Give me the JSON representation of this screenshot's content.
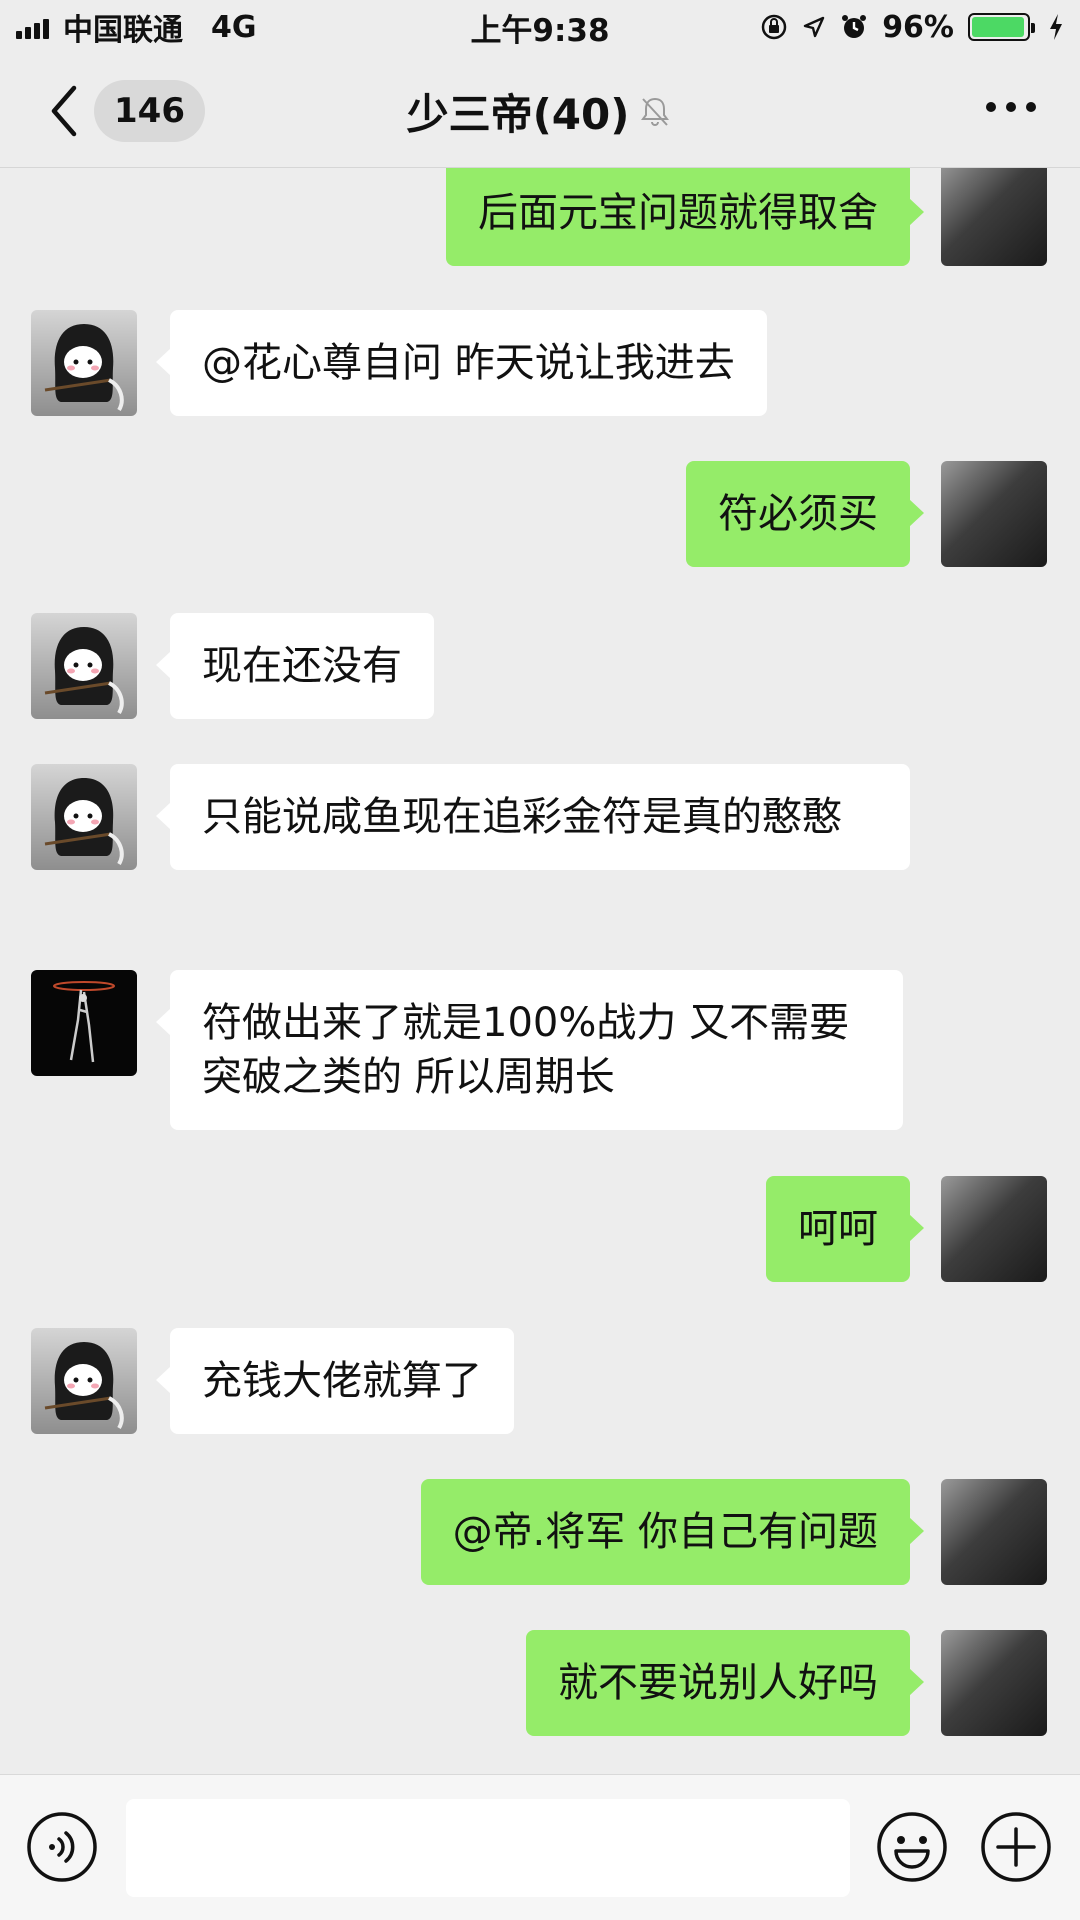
{
  "status_bar": {
    "carrier": "中国联通",
    "network": "4G",
    "time": "上午9:38",
    "battery": "96%",
    "battery_level": 0.96,
    "icons": [
      "signal-icon",
      "orientation-lock-icon",
      "location-icon",
      "alarm-icon",
      "battery-icon",
      "charging-icon"
    ]
  },
  "nav": {
    "back_count": "146",
    "title": "少三帝(40)",
    "icons": [
      "back-chevron-icon",
      "mute-bell-icon",
      "more-icon"
    ]
  },
  "messages": [
    {
      "side": "right",
      "avatar": "self",
      "text": "后面元宝问题就得取舍"
    },
    {
      "side": "left",
      "avatar": "reaper",
      "text": "@花心尊自问 昨天说让我进去"
    },
    {
      "side": "right",
      "avatar": "self",
      "text": "符必须买"
    },
    {
      "side": "left",
      "avatar": "reaper",
      "text": "现在还没有"
    },
    {
      "side": "left",
      "avatar": "reaper",
      "text": "只能说咸鱼现在追彩金符是真的憨憨"
    },
    {
      "side": "left",
      "avatar": "dark",
      "text": "符做出来了就是100%战力 又不需要突破之类的 所以周期长"
    },
    {
      "side": "right",
      "avatar": "self",
      "text": "呵呵"
    },
    {
      "side": "left",
      "avatar": "reaper",
      "text": "充钱大佬就算了"
    },
    {
      "side": "right",
      "avatar": "self",
      "text": "@帝.将军 你自己有问题"
    },
    {
      "side": "right",
      "avatar": "self",
      "text": "就不要说别人好吗"
    }
  ],
  "input_bar": {
    "value": "",
    "icons": [
      "voice-icon",
      "emoji-icon",
      "plus-icon"
    ]
  },
  "colors": {
    "background": "#ededed",
    "sent_bubble": "#95ec69",
    "received_bubble": "#ffffff",
    "battery_fill": "#4cd964"
  }
}
